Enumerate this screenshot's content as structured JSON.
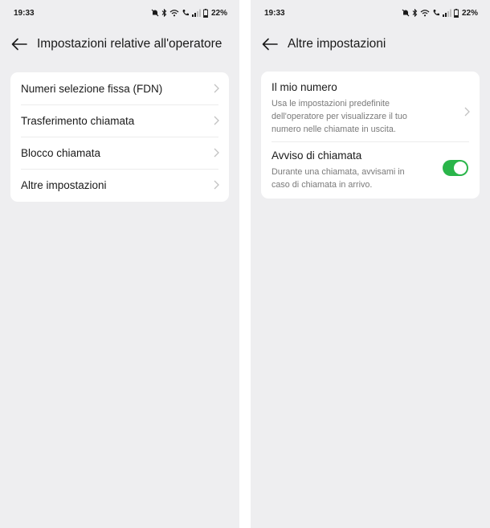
{
  "left": {
    "status": {
      "time": "19:33",
      "battery": "22%"
    },
    "header": {
      "title": "Impostazioni relative all'operatore"
    },
    "items": [
      {
        "label": "Numeri selezione fissa (FDN)"
      },
      {
        "label": "Trasferimento chiamata"
      },
      {
        "label": "Blocco chiamata"
      },
      {
        "label": "Altre impostazioni"
      }
    ]
  },
  "right": {
    "status": {
      "time": "19:33",
      "battery": "22%"
    },
    "header": {
      "title": "Altre impostazioni"
    },
    "my_number": {
      "title": "Il mio numero",
      "description": "Usa le impostazioni predefinite dell'operatore per visualizzare il tuo numero nelle chiamate in uscita."
    },
    "call_waiting": {
      "title": "Avviso di chiamata",
      "description": "Durante una chiamata, avvisami in caso di chiamata in arrivo.",
      "enabled": true
    }
  },
  "icons": {
    "status": [
      "bell-off-icon",
      "bluetooth-icon",
      "wifi-icon",
      "wifi-calling-icon",
      "signal-icon",
      "battery-icon"
    ],
    "back": "arrow-left-icon",
    "chevron": "chevron-right-icon"
  },
  "colors": {
    "background": "#eeeef0",
    "card": "#ffffff",
    "toggle_on": "#2ab54a",
    "secondary_text": "#7a7a7a"
  }
}
